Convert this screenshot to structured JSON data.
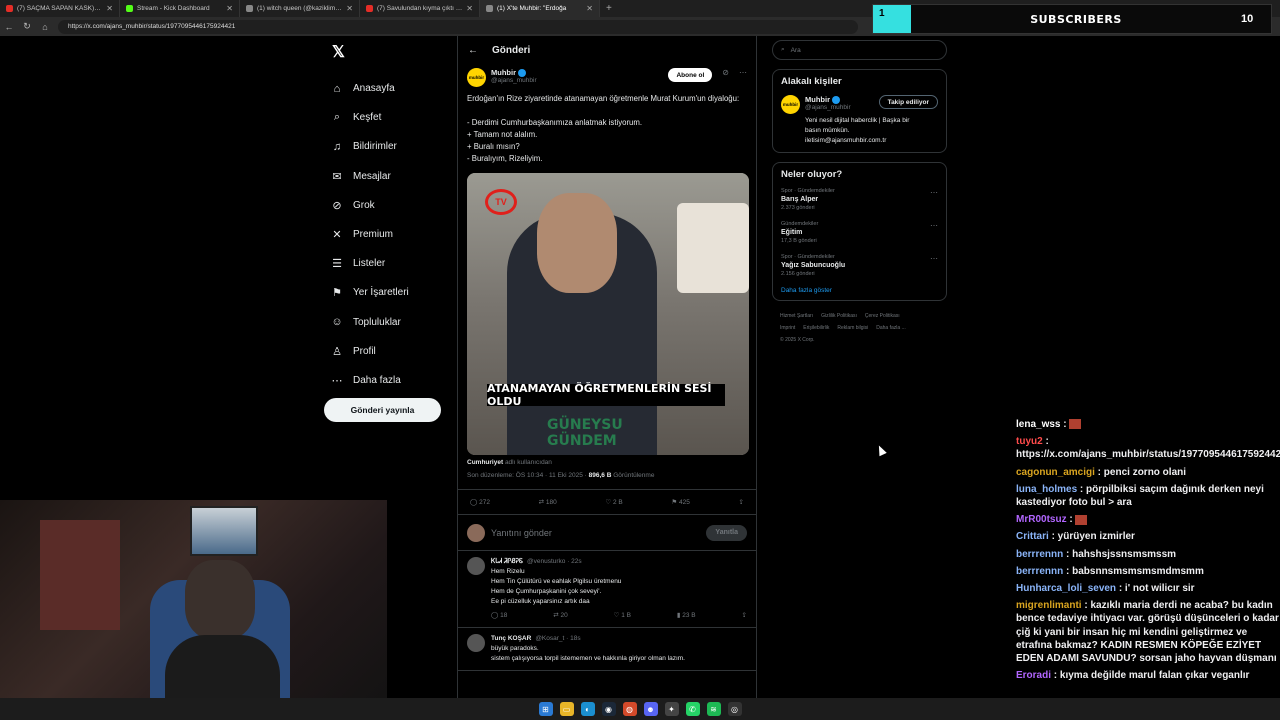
{
  "browser": {
    "tabs": [
      {
        "title": "(7) SAÇMA SAPAN KASK) 5Sriden",
        "color": "#e52d27"
      },
      {
        "title": "Stream - Kick Dashboard",
        "color": "#53fc18"
      },
      {
        "title": "(1) witch queen (@kaziklimaria) /",
        "color": "#888888"
      },
      {
        "title": "(7) Savulundan kıyma çıktı ben kı",
        "color": "#e52d27"
      },
      {
        "title": "(1) X'te Muhbir: \"Erdoğa",
        "color": "#888888"
      }
    ],
    "url": "https://x.com/ajans_muhbir/status/1977095446175924421"
  },
  "overlay": {
    "label": "SUBSCRIBERS",
    "count": "10",
    "progress_label": "1"
  },
  "leftnav": {
    "items": [
      {
        "label": "Anasayfa",
        "icon": "home-icon",
        "glyph": "⌂"
      },
      {
        "label": "Keşfet",
        "icon": "search-icon",
        "glyph": "⌕"
      },
      {
        "label": "Bildirimler",
        "icon": "bell-icon",
        "glyph": "♫"
      },
      {
        "label": "Mesajlar",
        "icon": "mail-icon",
        "glyph": "✉"
      },
      {
        "label": "Grok",
        "icon": "grok-icon",
        "glyph": "⊘"
      },
      {
        "label": "Premium",
        "icon": "x-premium-icon",
        "glyph": "✕"
      },
      {
        "label": "Listeler",
        "icon": "list-icon",
        "glyph": "☰"
      },
      {
        "label": "Yer İşaretleri",
        "icon": "bookmark-icon",
        "glyph": "⚑"
      },
      {
        "label": "Topluluklar",
        "icon": "people-icon",
        "glyph": "☺"
      },
      {
        "label": "Profil",
        "icon": "profile-icon",
        "glyph": "♙"
      },
      {
        "label": "Daha fazla",
        "icon": "more-icon",
        "glyph": "⋯"
      }
    ],
    "post_button": "Gönderi yayınla"
  },
  "post": {
    "header": "Gönderi",
    "author_name": "Muhbir",
    "author_handle": "@ajans_muhbir",
    "avatar_text": "muhbir",
    "subscribe": "Abone ol",
    "text_lines": [
      "Erdoğan'ın Rize ziyaretinde atanamayan öğretmenle Murat Kurum'un diyaloğu:",
      "",
      "- Derdimi Cumhurbaşkanımıza anlatmak istiyorum.",
      "+ Tamam not alalım.",
      "+ Buralı mısın?",
      "- Buralıyım, Rizeliyim."
    ],
    "media_caption": "ATANAMAYAN ÖĞRETMENLERİN SESİ OLDU",
    "media_badge": "TV",
    "watermark_1": "GÜNEYSU",
    "watermark_2": "GÜNDEM",
    "credit_name": "Cumhuriyet",
    "credit_suffix": "adlı kullanıcıdan",
    "meta_prefix": "Son düzenleme: ÖS 10:34 · 11 Eki 2025 ·",
    "views": "896,6 B",
    "views_label": "Görüntülenme",
    "stats": {
      "replies": "272",
      "reposts": "180",
      "likes": "2 B",
      "bookmarks": "425"
    },
    "reply_placeholder": "Yanıtını gönder",
    "reply_button": "Yanıtla"
  },
  "comments": [
    {
      "name": "ᏦᏓᏗ ᏘᎵᏰᎮᏋ",
      "handle": "@venusturko · 22s",
      "lines": [
        "Hem Rizelu",
        "Hem Tin Çülütürü ve eahlak Plgilsu üretmenu",
        "Hem de Çumhurpaşkanini çok seveyi'.",
        "Ee pi cüzelluk yaparsinız artık daa"
      ],
      "stats": [
        "18",
        "20",
        "1 B",
        "23 B"
      ]
    },
    {
      "name": "Tunç KOŞAR",
      "handle": "@Kosar_t · 18s",
      "lines": [
        "büyük paradoks.",
        "sistem çalışıyorsa torpil istememen ve hakkınla giriyor olman lazım."
      ],
      "stats": []
    }
  ],
  "right": {
    "search_placeholder": "Ara",
    "related_title": "Alakalı kişiler",
    "related": {
      "name": "Muhbir",
      "handle": "@ajans_muhbir",
      "button": "Takip ediliyor",
      "bio_lines": [
        "Yeni nesil dijital haberclik | Başka bir",
        "basın mümkün.",
        "iletisim@ajansmuhbir.com.tr"
      ]
    },
    "trends_title": "Neler oluyor?",
    "trends": [
      {
        "category": "Spor · Gündemdekiler",
        "name": "Barış Alper",
        "count": "2.373 gönderi"
      },
      {
        "category": "Gündemdekiler",
        "name": "Eğitim",
        "count": "17,3 B gönderi"
      },
      {
        "category": "Spor · Gündemdekiler",
        "name": "Yağız Sabuncuoğlu",
        "count": "2.156 gönderi"
      }
    ],
    "show_more": "Daha fazla göster",
    "footer_lines": [
      [
        "Hizmet Şartları",
        "Gizlilik Politikası",
        "Çerez Politikası"
      ],
      [
        "Imprint",
        "Erişilebilirlik",
        "Reklam bilgisi",
        "Daha fazla ..."
      ],
      [
        "© 2025 X Corp."
      ]
    ]
  },
  "chat": [
    {
      "user": "lena_wss",
      "color": "#ffffff",
      "text": " :",
      "emote": true
    },
    {
      "user": "tuyu2",
      "color": "#ff4b4b",
      "text": " : https://x.com/ajans_muhbir/status/1977095446175924421",
      "emote": false
    },
    {
      "user": "cagonun_amcigi",
      "color": "#daa520",
      "text": " : penci zorno olani",
      "emote": false
    },
    {
      "user": "luna_holmes",
      "color": "#8ab4f8",
      "text": " : pörpilbiksi saçım dağınık derken neyi kastediyor foto bul > ara",
      "emote": false
    },
    {
      "user": "MrR00tsuz",
      "color": "#b266ff",
      "text": " :",
      "emote": true
    },
    {
      "user": "Crittari",
      "color": "#8ab4f8",
      "text": " : yürüyen izmirler",
      "emote": false
    },
    {
      "user": "berrrennn",
      "color": "#8ab4f8",
      "text": " : hahshsjssnsmsmssm",
      "emote": false
    },
    {
      "user": "berrrennn",
      "color": "#8ab4f8",
      "text": " : babsnnsmsmsmsmdmsmm",
      "emote": false
    },
    {
      "user": "Hunharca_loli_seven",
      "color": "#8ab4f8",
      "text": " : i' not wilicır sir",
      "emote": false
    },
    {
      "user": "migrenlimanti",
      "color": "#daa520",
      "text": " : kazıklı maria derdi ne acaba? bu kadın bence tedaviye ihtiyacı var. görüşü düşünceleri o kadar çiğ ki yani bir insan hiç mi kendini geliştirmez ve etrafına bakmaz? KADIN RESMEN KÖPEĞE EZİYET EDEN ADAMI SAVUNDU? sorsan jaho hayvan düşmanı",
      "emote": false
    },
    {
      "user": "Eroradi",
      "color": "#b266ff",
      "text": " : kıyma değilde marul falan çıkar veganlır",
      "emote": false
    }
  ]
}
